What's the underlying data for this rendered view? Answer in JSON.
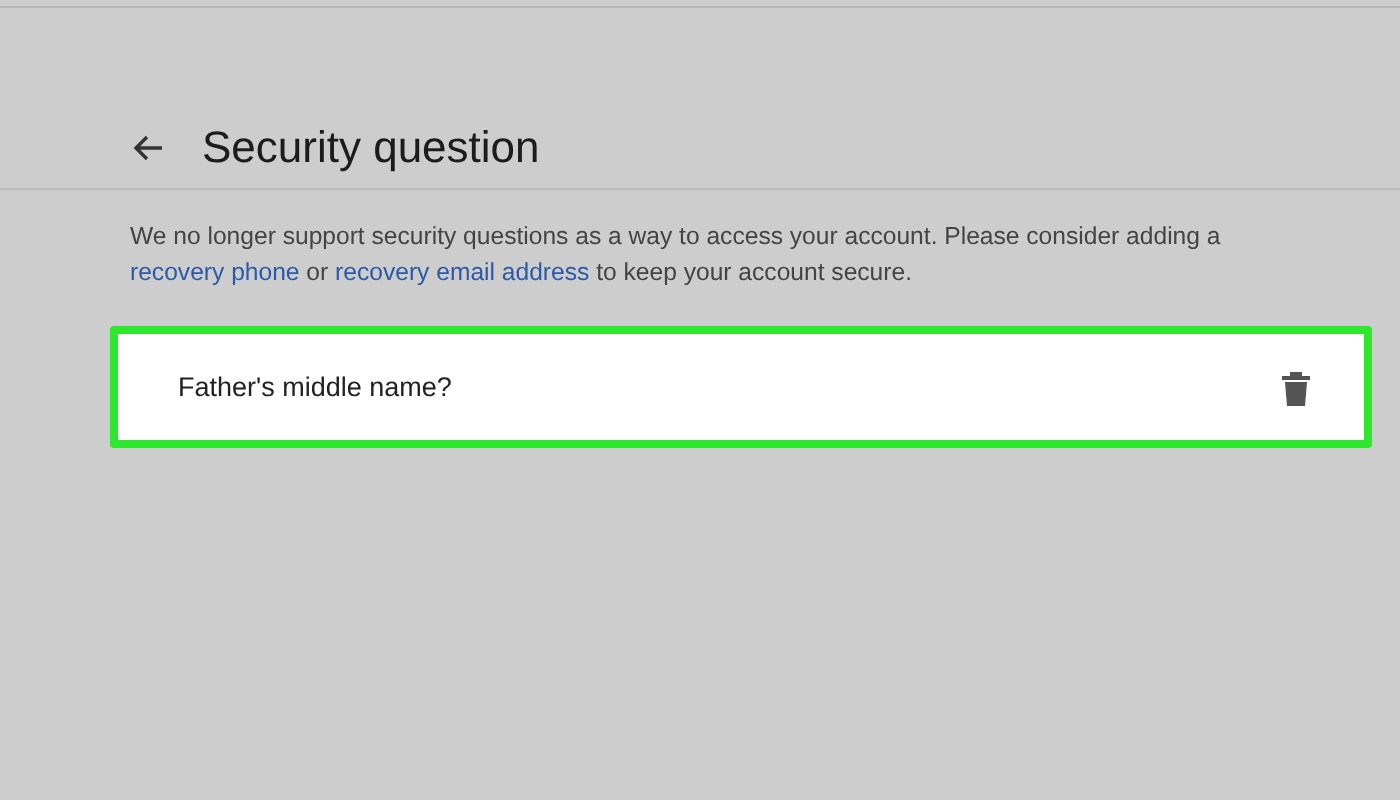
{
  "header": {
    "title": "Security question"
  },
  "notice": [
    {
      "kind": "text",
      "text": "We no longer support security questions as a way to access your account. Please consider adding a "
    },
    {
      "kind": "link",
      "text": "recovery phone"
    },
    {
      "kind": "text",
      "text": " or "
    },
    {
      "kind": "link",
      "text": "recovery email address"
    },
    {
      "kind": "text",
      "text": " to keep your account secure."
    }
  ],
  "question": {
    "text": "Father's middle name?",
    "highlighted": true
  }
}
